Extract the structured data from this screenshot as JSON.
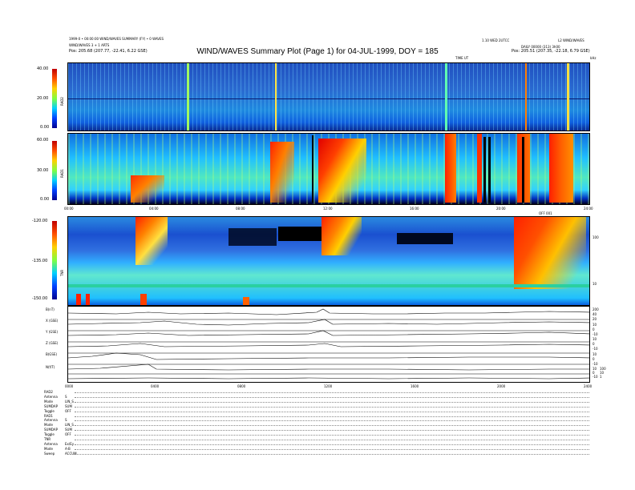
{
  "header": {
    "left_line1": "1999-0 • 00:00:00 WIND/WAVES SUMMARY (FY) • 0 WAVES",
    "left_line2": "WIND/WAVES 3 + 1 ARTS",
    "left_pos": "Pos:   205.68 (207.77, -22.41, 6.22 GSE)",
    "right_line1": "1.10 WED 2UTCC",
    "right_line2": "DAILY  00000 (313) 3h00",
    "right_pos": "Pos:   205.51 (207.35, -22.18, 6.79 GSE)",
    "right_corner": "L2 WIND/WAVES",
    "title": "WIND/WAVES Summary Plot (Page 1) for 04-JUL-1999, DOY = 185",
    "time_label": "TIME UT",
    "freq_unit": "kHz"
  },
  "panels": {
    "rad2": {
      "name": "RAD2",
      "ticks": [
        "40.00",
        "20.00",
        "0.00"
      ]
    },
    "rad1": {
      "name": "RAD1",
      "ticks": [
        "60.00",
        "30.00",
        "0.00"
      ]
    },
    "tnr": {
      "name": "TNR",
      "ticks": [
        "-120.00",
        "-135.00",
        "-150.00"
      ],
      "right_ticks": [
        "100",
        "10"
      ]
    },
    "time_ticks": [
      "00:00",
      "04:00",
      "08:00",
      "12:00",
      "16:00",
      "20:00",
      "24:00"
    ],
    "time_ticks_bottom": [
      "0000",
      "0400",
      "0800",
      "1200",
      "1600",
      "2000",
      "2400"
    ],
    "orbit_label": "OFF 001",
    "lines": [
      {
        "label": "B(nT)",
        "right": [
          "200",
          "40",
          "20"
        ]
      },
      {
        "label": "X (GSE)",
        "right": [
          "10",
          "0",
          "-10"
        ]
      },
      {
        "label": "Y (GSE)",
        "right": [
          "10",
          "0",
          "-10"
        ]
      },
      {
        "label": "Z (GSE)",
        "right": [
          "10",
          "0",
          "-10"
        ]
      },
      {
        "label": "B(GSE)",
        "right": [
          "10",
          "0",
          "-10"
        ]
      },
      {
        "label": "N(f/T)",
        "right": [
          "100",
          "10",
          "1"
        ]
      }
    ]
  },
  "table": [
    {
      "k": "RAD2",
      "v": ""
    },
    {
      "k": "Antenna",
      "v": "S"
    },
    {
      "k": "Mode",
      "v": "LIN_S"
    },
    {
      "k": "SUMDAP",
      "v": "SUM"
    },
    {
      "k": "Toggle",
      "v": "OFF"
    },
    {
      "k": "RAD1",
      "v": ""
    },
    {
      "k": "Antenna",
      "v": "S"
    },
    {
      "k": "Mode",
      "v": "LIN_S"
    },
    {
      "k": "SUMDAP",
      "v": "SUM"
    },
    {
      "k": "Toggle",
      "v": "OFF"
    },
    {
      "k": "TNR",
      "v": ""
    },
    {
      "k": "Antenna",
      "v": "Ex/Ey"
    },
    {
      "k": "Mode",
      "v": "A-B"
    },
    {
      "k": "Sweep",
      "v": "ACCUM"
    }
  ],
  "chart_data": [
    {
      "type": "heatmap",
      "title": "RAD2",
      "x": "time UT 00:00–24:00",
      "ylim": [
        0,
        40
      ],
      "yticks": [
        0,
        20,
        40
      ]
    },
    {
      "type": "heatmap",
      "title": "RAD1",
      "x": "time UT 00:00–24:00",
      "ylim": [
        0,
        60
      ],
      "yticks": [
        0,
        30,
        60
      ]
    },
    {
      "type": "heatmap",
      "title": "TNR",
      "x": "time UT 00:00–24:00",
      "ylim": [
        -150,
        -120
      ],
      "yticks": [
        -150,
        -135,
        -120
      ]
    }
  ]
}
